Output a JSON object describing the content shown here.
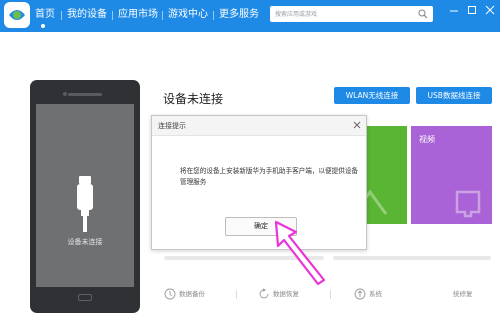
{
  "nav": {
    "items": [
      {
        "label": "首页",
        "active": true
      },
      {
        "label": "我的设备"
      },
      {
        "label": "应用市场"
      },
      {
        "label": "游戏中心"
      },
      {
        "label": "更多服务"
      }
    ]
  },
  "search": {
    "placeholder": "搜索应用或游戏",
    "icon": "search-icon"
  },
  "phone": {
    "status_label": "设备未连接"
  },
  "device": {
    "status_title": "设备未连接",
    "wlan_button": "WLAN无线连接",
    "usb_button": "USB数据线连接"
  },
  "tiles": [
    {
      "label": "",
      "color": "#5bb534"
    },
    {
      "label": "视频",
      "color": "#a963d6"
    }
  ],
  "bottom": {
    "items": [
      {
        "label": "数据备份",
        "icon": "backup-icon"
      },
      {
        "label": "数据恢复",
        "icon": "restore-icon"
      },
      {
        "label": "系统",
        "icon": "upload-icon"
      },
      {
        "label": "统修复",
        "icon": "repair-icon"
      }
    ]
  },
  "dialog": {
    "title": "连接提示",
    "message": "将在您的设备上安装新版华为手机助手客户端，以便提供设备管理服务",
    "ok_label": "确定"
  },
  "colors": {
    "accent": "#1e8ae6",
    "annotation_arrow": "#e934d8"
  }
}
